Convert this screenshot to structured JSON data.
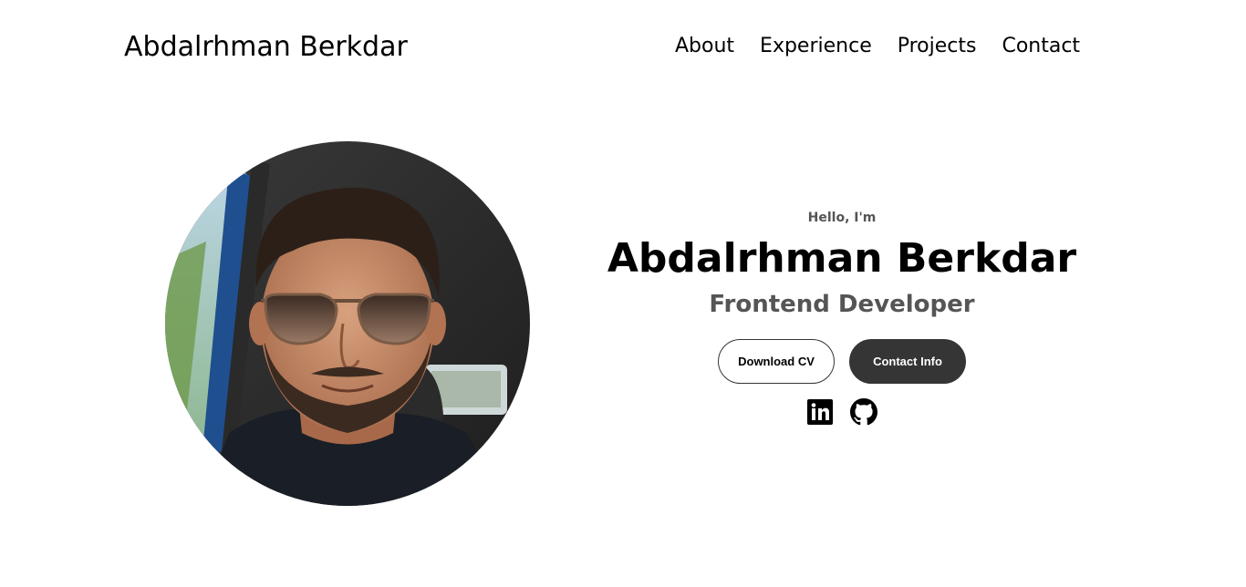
{
  "nav": {
    "logo": "Abdalrhman Berkdar",
    "links": [
      "About",
      "Experience",
      "Projects",
      "Contact"
    ]
  },
  "hero": {
    "greeting": "Hello, I'm",
    "name": "Abdalrhman Berkdar",
    "role": "Frontend Developer",
    "buttons": {
      "download_cv": "Download CV",
      "contact_info": "Contact Info"
    },
    "socials": [
      "linkedin-icon",
      "github-icon"
    ]
  },
  "colors": {
    "button_dark": "#353535",
    "role_text": "#555555"
  }
}
